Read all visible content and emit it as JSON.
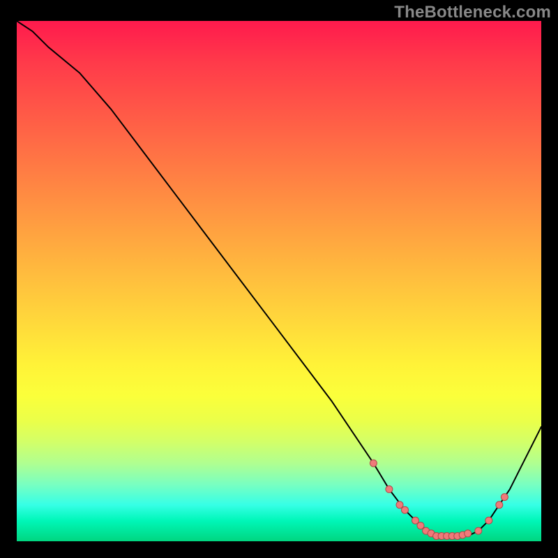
{
  "watermark": "TheBottleneck.com",
  "colors": {
    "curve_stroke": "#000000",
    "marker_fill": "#ef7a7a",
    "marker_stroke": "#b04848"
  },
  "chart_data": {
    "type": "line",
    "title": "",
    "xlabel": "",
    "ylabel": "",
    "xlim": [
      0,
      100
    ],
    "ylim": [
      0,
      100
    ],
    "grid": false,
    "legend": false,
    "annotations": [],
    "series": [
      {
        "name": "bottleneck_curve",
        "x": [
          0,
          3,
          6,
          12,
          18,
          24,
          30,
          36,
          42,
          48,
          54,
          60,
          64,
          68,
          71,
          74,
          77,
          80,
          82,
          84,
          86,
          88,
          90,
          92,
          94,
          96,
          98,
          100
        ],
        "y": [
          100,
          98,
          95,
          90,
          83,
          75,
          67,
          59,
          51,
          43,
          35,
          27,
          21,
          15,
          10,
          6,
          3,
          1,
          1,
          1,
          1,
          2,
          4,
          7,
          10,
          14,
          18,
          22
        ]
      }
    ],
    "markers": {
      "name": "highlighted_points",
      "x": [
        68,
        71,
        73,
        74,
        76,
        77,
        78,
        79,
        80,
        81,
        82,
        83,
        84,
        85,
        86,
        88,
        90,
        92,
        93
      ],
      "y": [
        15,
        10,
        7,
        6,
        4,
        3,
        2,
        1.5,
        1,
        1,
        1,
        1,
        1,
        1.2,
        1.5,
        2,
        4,
        7,
        8.5
      ],
      "size": 5
    }
  }
}
